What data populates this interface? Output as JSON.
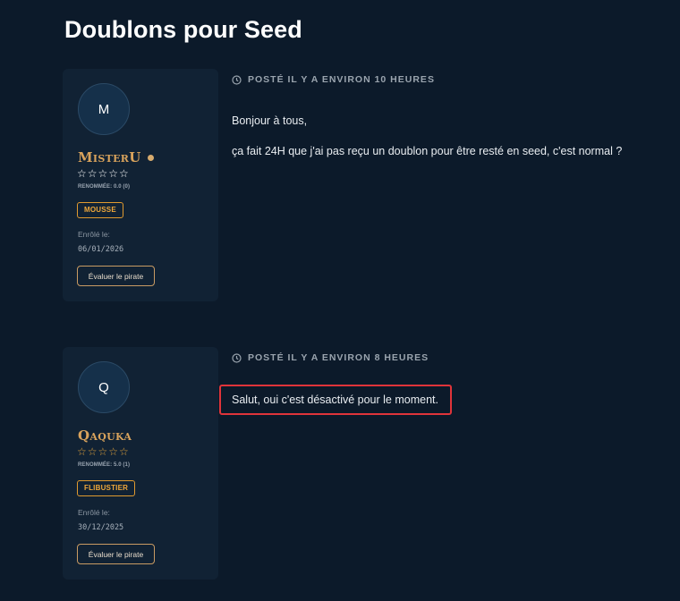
{
  "page": {
    "title": "Doublons pour Seed"
  },
  "posts": [
    {
      "author": {
        "avatar_letter": "M",
        "username": "MisterU",
        "online": true,
        "stars": "☆☆☆☆☆",
        "rating": 0,
        "reputation": "RENOMMÉE: 0.0 (0)",
        "rank": "MOUSSE",
        "enrolled_label": "Enrôlé le:",
        "enrolled_date": "06/01/2026",
        "rate_button": "Évaluer le pirate"
      },
      "meta": "POSTÉ  IL Y A ENVIRON 10 HEURES",
      "body": [
        "Bonjour à tous,",
        "ça fait 24H que j'ai pas reçu un doublon pour être resté en seed, c'est normal ?"
      ],
      "highlighted": false
    },
    {
      "author": {
        "avatar_letter": "Q",
        "username": "Qaquka",
        "online": false,
        "stars": "☆☆☆☆☆",
        "rating": 5,
        "reputation": "RENOMMÉE: 5.0 (1)",
        "rank": "FLIBUSTIER",
        "enrolled_label": "Enrôlé le:",
        "enrolled_date": "30/12/2025",
        "rate_button": "Évaluer le pirate"
      },
      "meta": "POSTÉ  IL Y A ENVIRON 8 HEURES",
      "body": [
        "Salut, oui c'est désactivé pour le moment."
      ],
      "highlighted": true
    }
  ],
  "colors": {
    "background": "#0c1a2a",
    "card": "#112234",
    "username": "#d9a35c",
    "badge": "#f0a83a",
    "highlight": "#e0343a"
  },
  "icons": {
    "clock": "clock-icon",
    "star": "star-outline-icon"
  }
}
